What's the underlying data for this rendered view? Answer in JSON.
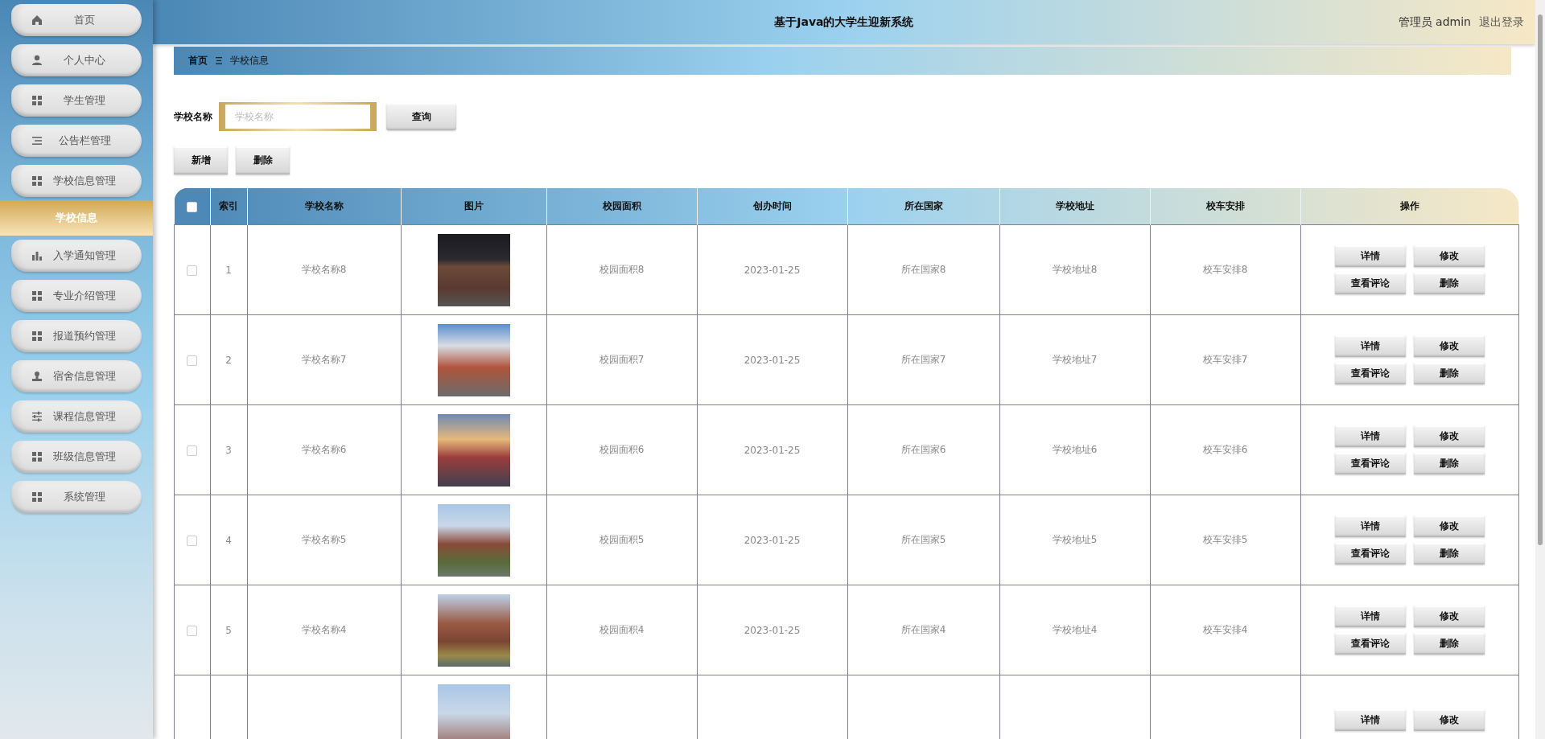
{
  "header": {
    "title": "基于Java的大学生迎新系统",
    "user": "管理员 admin",
    "logout": "退出登录"
  },
  "sidebar": {
    "items": [
      {
        "label": "首页",
        "selected": false
      },
      {
        "label": "个人中心",
        "selected": false
      },
      {
        "label": "学生管理",
        "selected": false
      },
      {
        "label": "公告栏管理",
        "selected": false
      },
      {
        "label": "学校信息管理",
        "selected": false,
        "expanded": true,
        "children": [
          {
            "label": "学校信息",
            "selected": true
          }
        ]
      },
      {
        "label": "入学通知管理",
        "selected": false
      },
      {
        "label": "专业介绍管理",
        "selected": false
      },
      {
        "label": "报道预约管理",
        "selected": false
      },
      {
        "label": "宿舍信息管理",
        "selected": false
      },
      {
        "label": "课程信息管理",
        "selected": false
      },
      {
        "label": "班级信息管理",
        "selected": false
      },
      {
        "label": "系统管理",
        "selected": false
      }
    ]
  },
  "breadcrumb": [
    "首页",
    "学校信息"
  ],
  "search": {
    "label": "学校名称",
    "placeholder": "学校名称",
    "button": "查询"
  },
  "actions": [
    "新增",
    "删除"
  ],
  "table": {
    "select_all": false,
    "columns": [
      "索引",
      "学校名称",
      "图片",
      "校园面积",
      "创办时间",
      "所在国家",
      "学校地址",
      "校车安排",
      "操作"
    ],
    "rows": [
      {
        "checked": false,
        "index": "1",
        "name": "学校名称8",
        "area": "校园面积8",
        "founded": "2023-01-25",
        "country": "所在国家8",
        "address": "学校地址8",
        "bus": "校车安排8",
        "actions": [
          "详情",
          "修改",
          "查看评论",
          "删除"
        ]
      },
      {
        "checked": false,
        "index": "2",
        "name": "学校名称7",
        "area": "校园面积7",
        "founded": "2023-01-25",
        "country": "所在国家7",
        "address": "学校地址7",
        "bus": "校车安排7",
        "actions": [
          "详情",
          "修改",
          "查看评论",
          "删除"
        ]
      },
      {
        "checked": false,
        "index": "3",
        "name": "学校名称6",
        "area": "校园面积6",
        "founded": "2023-01-25",
        "country": "所在国家6",
        "address": "学校地址6",
        "bus": "校车安排6",
        "actions": [
          "详情",
          "修改",
          "查看评论",
          "删除"
        ]
      },
      {
        "checked": false,
        "index": "4",
        "name": "学校名称5",
        "area": "校园面积5",
        "founded": "2023-01-25",
        "country": "所在国家5",
        "address": "学校地址5",
        "bus": "校车安排5",
        "actions": [
          "详情",
          "修改",
          "查看评论",
          "删除"
        ]
      },
      {
        "checked": false,
        "index": "5",
        "name": "学校名称4",
        "area": "校园面积4",
        "founded": "2023-01-25",
        "country": "所在国家4",
        "address": "学校地址4",
        "bus": "校车安排4",
        "actions": [
          "详情",
          "修改",
          "查看评论",
          "删除"
        ]
      },
      {
        "actions": [
          "详情",
          "修改"
        ]
      }
    ]
  }
}
